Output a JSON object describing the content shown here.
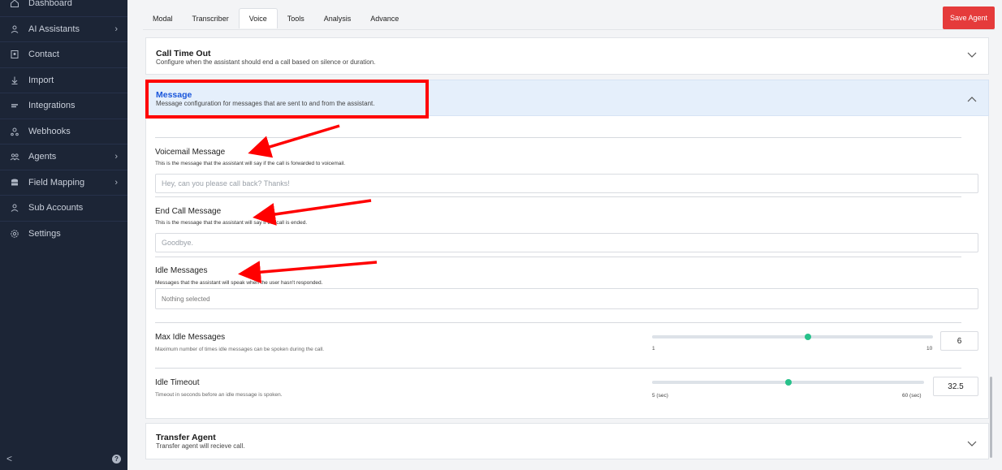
{
  "sidebar": {
    "items": [
      {
        "label": "Dashboard",
        "icon": "home-icon",
        "chevron": false
      },
      {
        "label": "AI Assistants",
        "icon": "user-icon",
        "chevron": true
      },
      {
        "label": "Contact",
        "icon": "contact-icon",
        "chevron": false
      },
      {
        "label": "Import",
        "icon": "import-icon",
        "chevron": false
      },
      {
        "label": "Integrations",
        "icon": "plug-icon",
        "chevron": false
      },
      {
        "label": "Webhooks",
        "icon": "webhook-icon",
        "chevron": false
      },
      {
        "label": "Agents",
        "icon": "agents-icon",
        "chevron": true
      },
      {
        "label": "Field Mapping",
        "icon": "database-icon",
        "chevron": true
      },
      {
        "label": "Sub Accounts",
        "icon": "user-icon",
        "chevron": false
      },
      {
        "label": "Settings",
        "icon": "gear-icon",
        "chevron": false
      }
    ],
    "collapse_glyph": "<",
    "help_glyph": "?"
  },
  "tabs": [
    "Modal",
    "Transcriber",
    "Voice",
    "Tools",
    "Analysis",
    "Advance"
  ],
  "active_tab": "Voice",
  "save_button": "Save Agent",
  "call_timeout": {
    "title": "Call Time Out",
    "desc": "Configure when the assistant should end a call based on silence or duration."
  },
  "message": {
    "title": "Message",
    "desc": "Message configuration for messages that are sent to and from the assistant."
  },
  "voicemail": {
    "title": "Voicemail Message",
    "desc": "This is the message that the assistant will say if the call is forwarded to voicemail.",
    "placeholder": "Hey, can you please call back? Thanks!"
  },
  "end_call": {
    "title": "End Call Message",
    "desc": "This is the message that the assistant will say if the call is ended.",
    "placeholder": "Goodbye."
  },
  "idle_messages": {
    "title": "Idle Messages",
    "desc": "Messages that the assistant will speak when the user hasn't responded.",
    "value": "Nothing selected"
  },
  "max_idle": {
    "title": "Max Idle Messages",
    "desc": "Maximum number of times idle messages can be spoken during the call.",
    "min_label": "1",
    "max_label": "10",
    "value": "6",
    "min": 1,
    "max": 10,
    "current": 6
  },
  "idle_timeout": {
    "title": "Idle Timeout",
    "desc": "Timeout in seconds before an idle message is spoken.",
    "min_label": "5 (sec)",
    "max_label": "60 (sec)",
    "value": "32.5",
    "min": 5,
    "max": 60,
    "current": 32.5
  },
  "transfer": {
    "title": "Transfer Agent",
    "desc": "Transfer agent will recieve call."
  },
  "colors": {
    "sidebar_bg": "#1c2536",
    "save_button": "#e53b3b",
    "message_header_bg": "#e5effb",
    "message_title": "#1a56db",
    "slider_thumb": "#27c18a",
    "annotation_red": "#ff0000"
  }
}
